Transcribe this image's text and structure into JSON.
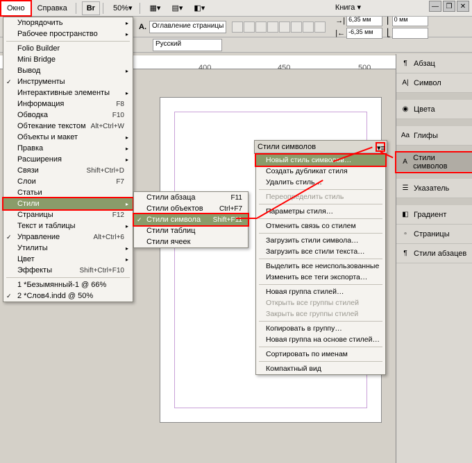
{
  "topbar": {
    "window_menu": "Окно",
    "help_menu": "Справка",
    "br": "Br",
    "zoom": "50%",
    "book": "Книга"
  },
  "toolbar": {
    "outline_select": "Оглавление страницы",
    "lang_select": "Русский",
    "dim1": "6,35 мм",
    "dim2": "-6,35 мм",
    "dim3": "0 мм",
    "dim4": ""
  },
  "ruler": {
    "t1": "400",
    "t2": "450",
    "t3": "500"
  },
  "menu1": [
    {
      "label": "Упорядочить",
      "arrow": true
    },
    {
      "label": "Рабочее пространство",
      "arrow": true
    },
    {
      "sep": true
    },
    {
      "label": "Folio Builder"
    },
    {
      "label": "Mini Bridge"
    },
    {
      "label": "Вывод",
      "arrow": true
    },
    {
      "label": "Инструменты",
      "check": true
    },
    {
      "label": "Интерактивные элементы",
      "arrow": true
    },
    {
      "label": "Информация",
      "shortcut": "F8"
    },
    {
      "label": "Обводка",
      "shortcut": "F10"
    },
    {
      "label": "Обтекание текстом",
      "shortcut": "Alt+Ctrl+W"
    },
    {
      "label": "Объекты и макет",
      "arrow": true
    },
    {
      "label": "Правка",
      "arrow": true
    },
    {
      "label": "Расширения",
      "arrow": true
    },
    {
      "label": "Связи",
      "shortcut": "Shift+Ctrl+D"
    },
    {
      "label": "Слои",
      "shortcut": "F7"
    },
    {
      "label": "Статьи"
    },
    {
      "label": "Стили",
      "arrow": true,
      "highlight": true,
      "redbox": true
    },
    {
      "label": "Страницы",
      "shortcut": "F12"
    },
    {
      "label": "Текст и таблицы",
      "arrow": true
    },
    {
      "label": "Управление",
      "shortcut": "Alt+Ctrl+6",
      "check": true
    },
    {
      "label": "Утилиты",
      "arrow": true
    },
    {
      "label": "Цвет",
      "arrow": true
    },
    {
      "label": "Эффекты",
      "shortcut": "Shift+Ctrl+F10"
    },
    {
      "sep": true
    },
    {
      "label": "1 *Безымянный-1 @ 66%"
    },
    {
      "label": "2 *Слов4.indd @ 50%",
      "check": true
    }
  ],
  "menu2": [
    {
      "label": "Стили абзаца",
      "shortcut": "F11"
    },
    {
      "label": "Стили объектов",
      "shortcut": "Ctrl+F7"
    },
    {
      "label": "Стили символа",
      "shortcut": "Shift+F11",
      "check": true,
      "highlight": true,
      "redbox": true
    },
    {
      "label": "Стили таблиц"
    },
    {
      "label": "Стили ячеек"
    }
  ],
  "cs_panel_title": "Стили символов",
  "menu3": [
    {
      "label": "Новый стиль символов…",
      "highlight": true,
      "redbox": true
    },
    {
      "label": "Создать дубликат стиля"
    },
    {
      "label": "Удалить стиль…"
    },
    {
      "sep": true
    },
    {
      "label": "Переопределить стиль",
      "disabled": true
    },
    {
      "sep": true
    },
    {
      "label": "Параметры стиля…"
    },
    {
      "sep": true
    },
    {
      "label": "Отменить связь со стилем"
    },
    {
      "sep": true
    },
    {
      "label": "Загрузить стили символа…"
    },
    {
      "label": "Загрузить все стили текста…"
    },
    {
      "sep": true
    },
    {
      "label": "Выделить все неиспользованные"
    },
    {
      "label": "Изменить все теги экспорта…"
    },
    {
      "sep": true
    },
    {
      "label": "Новая группа стилей…"
    },
    {
      "label": "Открыть все группы стилей",
      "disabled": true
    },
    {
      "label": "Закрыть все группы стилей",
      "disabled": true
    },
    {
      "sep": true
    },
    {
      "label": "Копировать в группу…"
    },
    {
      "label": "Новая группа на основе стилей…"
    },
    {
      "sep": true
    },
    {
      "label": "Сортировать по именам"
    },
    {
      "sep": true
    },
    {
      "label": "Компактный вид"
    }
  ],
  "panels": [
    {
      "label": "Абзац",
      "icon": "¶"
    },
    {
      "label": "Символ",
      "icon": "A|"
    },
    {
      "spacer": true
    },
    {
      "label": "Цвета",
      "icon": "◉"
    },
    {
      "spacer": true
    },
    {
      "label": "Глифы",
      "icon": "Aa"
    },
    {
      "spacer": true
    },
    {
      "label": "Стили символов",
      "icon": "A",
      "sel": true,
      "redbox": true
    },
    {
      "spacer": true
    },
    {
      "label": "Указатель",
      "icon": "☰"
    },
    {
      "spacer": true
    },
    {
      "label": "Градиент",
      "icon": "◧"
    },
    {
      "label": "Страницы",
      "icon": "▫"
    },
    {
      "label": "Стили абзацев",
      "icon": "¶"
    }
  ]
}
